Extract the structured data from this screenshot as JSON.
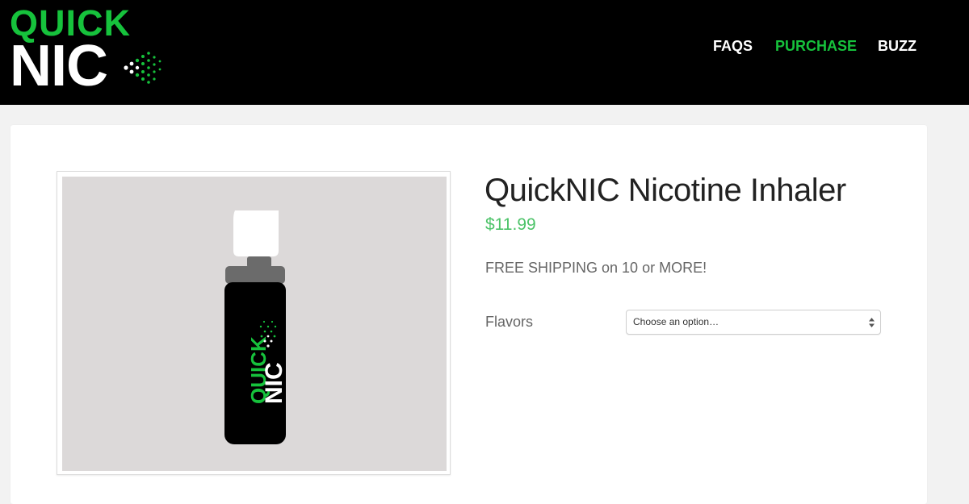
{
  "brand": {
    "logo_line1": "QUICK",
    "logo_line2": "NIC",
    "green": "#16c23c",
    "white": "#ffffff"
  },
  "nav": {
    "items": [
      {
        "label": "FAQS",
        "active": false
      },
      {
        "label": "PURCHASE",
        "active": true
      },
      {
        "label": "BUZZ",
        "active": false
      }
    ]
  },
  "product": {
    "title": "QuickNIC Nicotine Inhaler",
    "price": "$11.99",
    "price_color": "#4cc368",
    "shipping_note": "FREE SHIPPING on 10 or MORE!",
    "image": {
      "label_line1": "QUICK",
      "label_line2": "NIC",
      "icon": "inhaler-bottle-icon"
    },
    "flavors": {
      "label": "Flavors",
      "selected": "Choose an option…"
    }
  }
}
